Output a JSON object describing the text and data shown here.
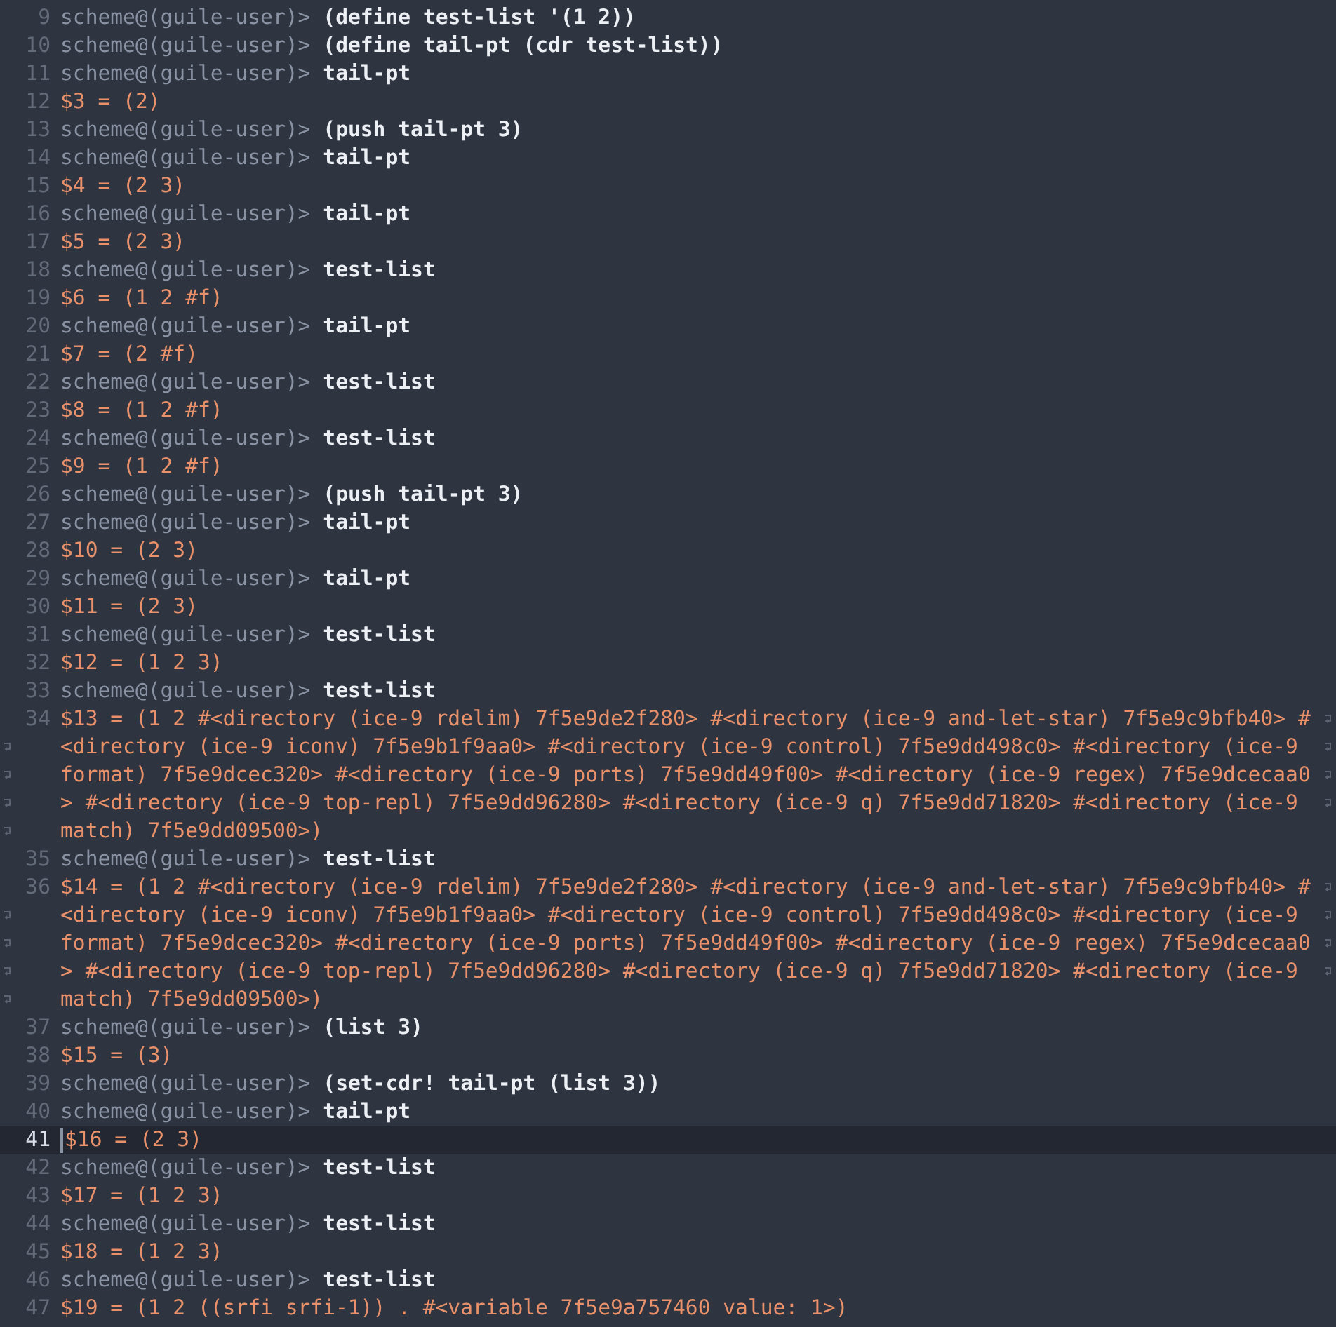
{
  "lines": [
    {
      "number": "9",
      "kind": "prompt",
      "prompt": "scheme@(guile-user)>",
      "input": "(define test-list '(1 2))",
      "current": false
    },
    {
      "number": "10",
      "kind": "prompt",
      "prompt": "scheme@(guile-user)>",
      "input": "(define tail-pt (cdr test-list))",
      "current": false
    },
    {
      "number": "11",
      "kind": "prompt",
      "prompt": "scheme@(guile-user)>",
      "input": "tail-pt",
      "current": false
    },
    {
      "number": "12",
      "kind": "output",
      "segments": [
        "$3 = (2)"
      ],
      "current": false
    },
    {
      "number": "13",
      "kind": "prompt",
      "prompt": "scheme@(guile-user)>",
      "input": "(push tail-pt 3)",
      "current": false
    },
    {
      "number": "14",
      "kind": "prompt",
      "prompt": "scheme@(guile-user)>",
      "input": "tail-pt",
      "current": false
    },
    {
      "number": "15",
      "kind": "output",
      "segments": [
        "$4 = (2 3)"
      ],
      "current": false
    },
    {
      "number": "16",
      "kind": "prompt",
      "prompt": "scheme@(guile-user)>",
      "input": "tail-pt",
      "current": false
    },
    {
      "number": "17",
      "kind": "output",
      "segments": [
        "$5 = (2 3)"
      ],
      "current": false
    },
    {
      "number": "18",
      "kind": "prompt",
      "prompt": "scheme@(guile-user)>",
      "input": "test-list",
      "current": false
    },
    {
      "number": "19",
      "kind": "output",
      "segments": [
        "$6 = (1 2 #f)"
      ],
      "current": false
    },
    {
      "number": "20",
      "kind": "prompt",
      "prompt": "scheme@(guile-user)>",
      "input": "tail-pt",
      "current": false
    },
    {
      "number": "21",
      "kind": "output",
      "segments": [
        "$7 = (2 #f)"
      ],
      "current": false
    },
    {
      "number": "22",
      "kind": "prompt",
      "prompt": "scheme@(guile-user)>",
      "input": "test-list",
      "current": false
    },
    {
      "number": "23",
      "kind": "output",
      "segments": [
        "$8 = (1 2 #f)"
      ],
      "current": false
    },
    {
      "number": "24",
      "kind": "prompt",
      "prompt": "scheme@(guile-user)>",
      "input": "test-list",
      "current": false
    },
    {
      "number": "25",
      "kind": "output",
      "segments": [
        "$9 = (1 2 #f)"
      ],
      "current": false
    },
    {
      "number": "26",
      "kind": "prompt",
      "prompt": "scheme@(guile-user)>",
      "input": "(push tail-pt 3)",
      "current": false
    },
    {
      "number": "27",
      "kind": "prompt",
      "prompt": "scheme@(guile-user)>",
      "input": "tail-pt",
      "current": false
    },
    {
      "number": "28",
      "kind": "output",
      "segments": [
        "$10 = (2 3)"
      ],
      "current": false
    },
    {
      "number": "29",
      "kind": "prompt",
      "prompt": "scheme@(guile-user)>",
      "input": "tail-pt",
      "current": false
    },
    {
      "number": "30",
      "kind": "output",
      "segments": [
        "$11 = (2 3)"
      ],
      "current": false
    },
    {
      "number": "31",
      "kind": "prompt",
      "prompt": "scheme@(guile-user)>",
      "input": "test-list",
      "current": false
    },
    {
      "number": "32",
      "kind": "output",
      "segments": [
        "$12 = (1 2 3)"
      ],
      "current": false
    },
    {
      "number": "33",
      "kind": "prompt",
      "prompt": "scheme@(guile-user)>",
      "input": "test-list",
      "current": false
    },
    {
      "number": "34",
      "kind": "output",
      "segments": [
        "$13 = (1 2 #<directory (ice-9 rdelim) 7f5e9de2f280> #<directory (ice-9 and-let-star) 7f5e9c9bfb40> #",
        "<directory (ice-9 iconv) 7f5e9b1f9aa0> #<directory (ice-9 control) 7f5e9dd498c0> #<directory (ice-9",
        "format) 7f5e9dcec320> #<directory (ice-9 ports) 7f5e9dd49f00> #<directory (ice-9 regex) 7f5e9dcecaa0",
        "> #<directory (ice-9 top-repl) 7f5e9dd96280> #<directory (ice-9 q) 7f5e9dd71820> #<directory (ice-9",
        "match) 7f5e9dd09500>)"
      ],
      "current": false
    },
    {
      "number": "35",
      "kind": "prompt",
      "prompt": "scheme@(guile-user)>",
      "input": "test-list",
      "current": false
    },
    {
      "number": "36",
      "kind": "output",
      "segments": [
        "$14 = (1 2 #<directory (ice-9 rdelim) 7f5e9de2f280> #<directory (ice-9 and-let-star) 7f5e9c9bfb40> #",
        "<directory (ice-9 iconv) 7f5e9b1f9aa0> #<directory (ice-9 control) 7f5e9dd498c0> #<directory (ice-9",
        "format) 7f5e9dcec320> #<directory (ice-9 ports) 7f5e9dd49f00> #<directory (ice-9 regex) 7f5e9dcecaa0",
        "> #<directory (ice-9 top-repl) 7f5e9dd96280> #<directory (ice-9 q) 7f5e9dd71820> #<directory (ice-9",
        "match) 7f5e9dd09500>)"
      ],
      "current": false
    },
    {
      "number": "37",
      "kind": "prompt",
      "prompt": "scheme@(guile-user)>",
      "input": "(list 3)",
      "current": false
    },
    {
      "number": "38",
      "kind": "output",
      "segments": [
        "$15 = (3)"
      ],
      "current": false
    },
    {
      "number": "39",
      "kind": "prompt",
      "prompt": "scheme@(guile-user)>",
      "input": "(set-cdr! tail-pt (list 3))",
      "current": false
    },
    {
      "number": "40",
      "kind": "prompt",
      "prompt": "scheme@(guile-user)>",
      "input": "tail-pt",
      "current": false
    },
    {
      "number": "41",
      "kind": "output",
      "segments": [
        "$16 = (2 3)"
      ],
      "current": true
    },
    {
      "number": "42",
      "kind": "prompt",
      "prompt": "scheme@(guile-user)>",
      "input": "test-list",
      "current": false
    },
    {
      "number": "43",
      "kind": "output",
      "segments": [
        "$17 = (1 2 3)"
      ],
      "current": false
    },
    {
      "number": "44",
      "kind": "prompt",
      "prompt": "scheme@(guile-user)>",
      "input": "test-list",
      "current": false
    },
    {
      "number": "45",
      "kind": "output",
      "segments": [
        "$18 = (1 2 3)"
      ],
      "current": false
    },
    {
      "number": "46",
      "kind": "prompt",
      "prompt": "scheme@(guile-user)>",
      "input": "test-list",
      "current": false
    },
    {
      "number": "47",
      "kind": "output",
      "segments": [
        "$19 = (1 2 ((srfi srfi-1)) . #<variable 7f5e9a757460 value: 1>)"
      ],
      "current": false
    }
  ]
}
